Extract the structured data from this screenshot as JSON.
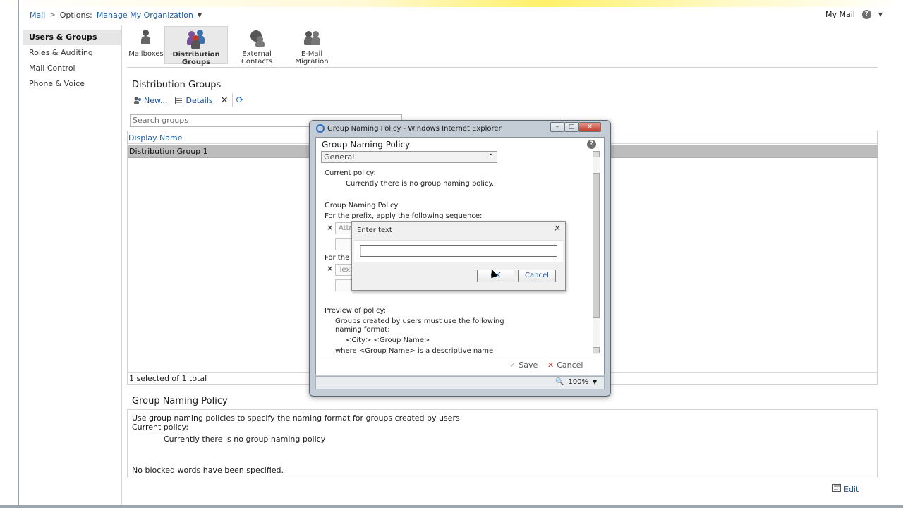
{
  "breadcrumb": {
    "mail": "Mail",
    "separator": ">",
    "options_label": "Options:",
    "organization": "Manage My Organization"
  },
  "topright": {
    "my_mail": "My Mail",
    "help": "?"
  },
  "nav": {
    "items": [
      {
        "label": "Users & Groups",
        "active": true
      },
      {
        "label": "Roles & Auditing"
      },
      {
        "label": "Mail Control"
      },
      {
        "label": "Phone & Voice"
      }
    ]
  },
  "ribbon": {
    "items": [
      {
        "label": "Mailboxes",
        "icon": "mailbox-user-icon"
      },
      {
        "label": "Distribution Groups",
        "icon": "distribution-groups-icon",
        "active": true
      },
      {
        "label": "External Contacts",
        "icon": "external-contacts-icon"
      },
      {
        "label": "E-Mail Migration",
        "icon": "email-migration-icon"
      }
    ]
  },
  "section": {
    "title": "Distribution Groups",
    "toolbar": {
      "new": "New...",
      "details": "Details"
    },
    "search_placeholder": "Search groups",
    "column_header": "Display Name",
    "rows": [
      "Distribution Group 1"
    ],
    "status": "1 selected of 1 total"
  },
  "details": {
    "title": "Group Naming Policy",
    "line1": "Use group naming policies to specify the naming format for groups created by users.",
    "line2": "Current policy:",
    "line3": "Currently there is no group naming policy",
    "line4": "No blocked words have been specified.",
    "edit": "Edit"
  },
  "ie_window": {
    "title": "Group Naming Policy - Windows Internet Explorer",
    "zoom": "100%",
    "dialog": {
      "title": "Group Naming Policy",
      "section": "General",
      "current_policy_label": "Current policy:",
      "current_policy_value": "Currently there is no group naming policy.",
      "policy_heading": "Group Naming Policy",
      "prefix_text": "For the prefix, apply the following sequence:",
      "prefix_item": "Attri",
      "suffix_text": "For the s",
      "suffix_item": "Text",
      "preview_label": "Preview of policy:",
      "preview_line1": "Groups created by users must use the following",
      "preview_line2": "naming format:",
      "preview_format": "<City> <Group Name>",
      "preview_where": "where <Group Name> is a descriptive name",
      "save": "Save",
      "cancel": "Cancel"
    }
  },
  "enter_text_popup": {
    "title": "Enter text",
    "input_value": "",
    "ok": "OK",
    "cancel": "Cancel"
  },
  "colors": {
    "link": "#1f5ea8",
    "selected_row": "#bdbdbd",
    "ie_frame": "#c4ccd6"
  }
}
